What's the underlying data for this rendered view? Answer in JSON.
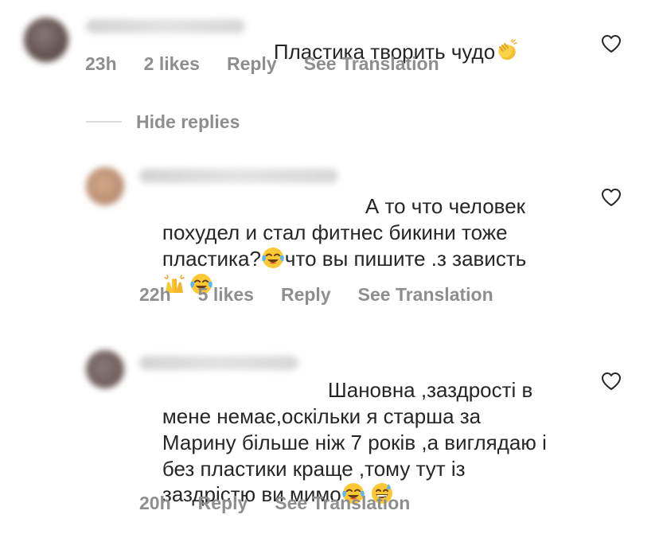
{
  "comments": [
    {
      "text_line1": "Пластика творить чудо",
      "time": "23h",
      "likes": "2 likes",
      "reply": "Reply",
      "translate": "See Translation"
    },
    {
      "text_line1": "А то что человек",
      "text_line2": "похудел и стал фитнес бикини тоже",
      "text_line3a": "пластика?",
      "text_line3b": "что вы пишите .з зависть",
      "time": "22h",
      "likes": "5 likes",
      "reply": "Reply",
      "translate": "See Translation"
    },
    {
      "text_line1": "Шановна ,заздрості в",
      "text_line2": "мене немає,оскільки я старша за",
      "text_line3": "Марину більше ніж 7 років ,а виглядаю і",
      "text_line4": "без пластики краще ,тому тут із",
      "text_line5": "заздрістю ви мимо",
      "time": "20h",
      "reply": "Reply",
      "translate": "See Translation"
    }
  ],
  "hide_replies_label": "Hide replies",
  "icons": {
    "heart": "heart-outline-icon",
    "clap": "clapping-hands-emoji",
    "tears_of_joy": "face-with-tears-of-joy-emoji",
    "raised_hands": "raising-hands-emoji",
    "sweat_smile": "grinning-face-with-sweat-emoji"
  },
  "colors": {
    "text": "#262626",
    "meta": "#8e8e8e",
    "divider": "#dbdbdb"
  }
}
